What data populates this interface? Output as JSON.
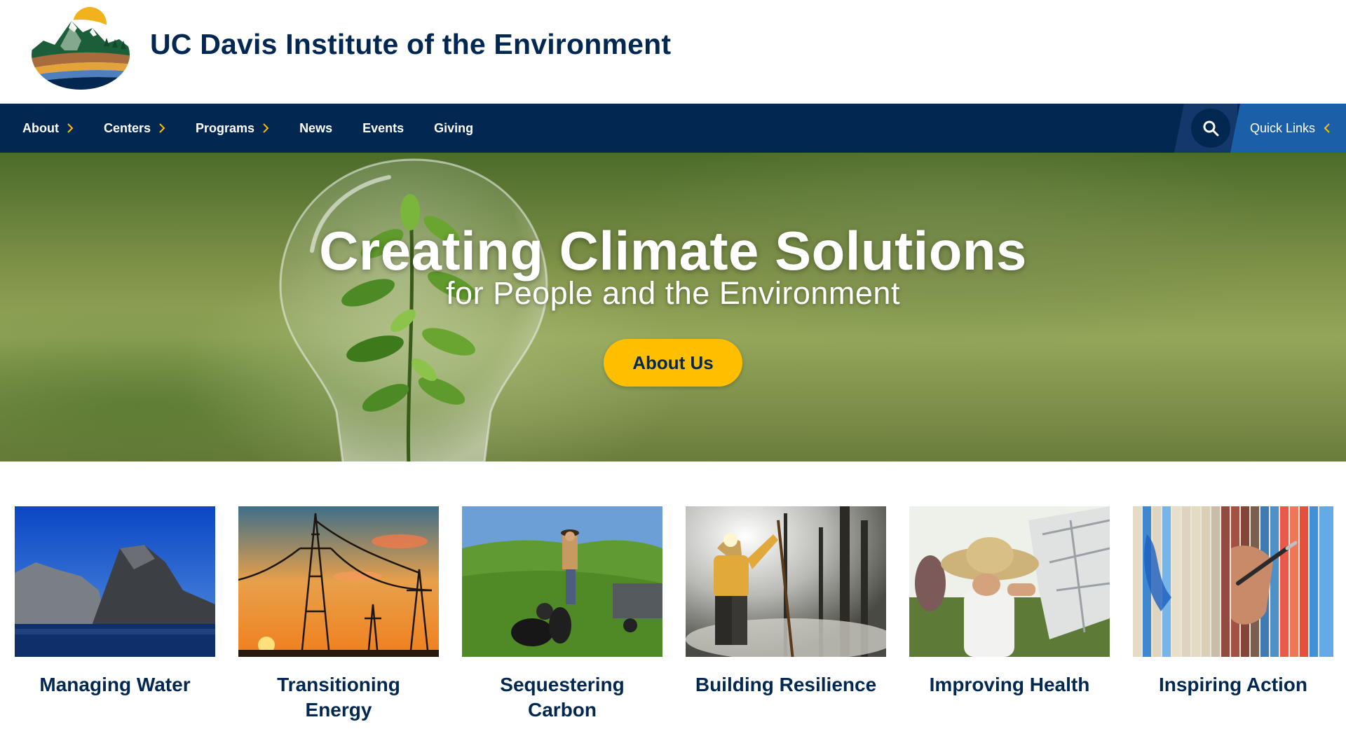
{
  "header": {
    "site_title": "UC Davis Institute of the Environment"
  },
  "nav": {
    "items": [
      {
        "label": "About",
        "has_submenu": true
      },
      {
        "label": "Centers",
        "has_submenu": true
      },
      {
        "label": "Programs",
        "has_submenu": true
      },
      {
        "label": "News",
        "has_submenu": false
      },
      {
        "label": "Events",
        "has_submenu": false
      },
      {
        "label": "Giving",
        "has_submenu": false
      }
    ],
    "search_icon": "search-icon",
    "quick_links_label": "Quick Links"
  },
  "hero": {
    "title": "Creating Climate Solutions",
    "subtitle": "for People and the Environment",
    "button_label": "About Us"
  },
  "cards": [
    {
      "label": "Managing Water"
    },
    {
      "label": "Transitioning Energy"
    },
    {
      "label": "Sequestering Carbon"
    },
    {
      "label": "Building Resilience"
    },
    {
      "label": "Improving Health"
    },
    {
      "label": "Inspiring Action"
    }
  ],
  "colors": {
    "navy": "#022851",
    "gold": "#ffbf00",
    "quick_links_blue": "#1a5fa8",
    "search_panel": "#13396c"
  }
}
